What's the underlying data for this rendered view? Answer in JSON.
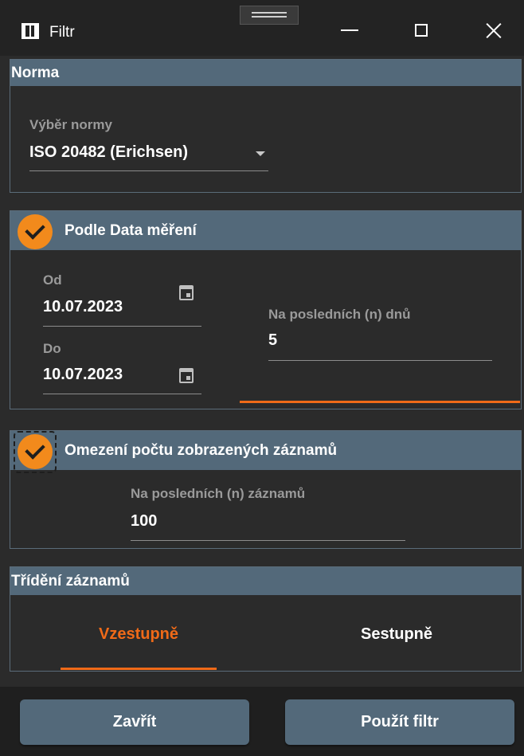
{
  "window": {
    "title": "Filtr",
    "controls": [
      "minimize-icon",
      "maximize-icon",
      "close-icon"
    ]
  },
  "norma": {
    "header": "Norma",
    "label": "Výběr normy",
    "value": "ISO 20482 (Erichsen)"
  },
  "date_filter": {
    "header": "Podle Data měření",
    "checked": true,
    "from_label": "Od",
    "from_value": "10.07.2023",
    "to_label": "Do",
    "to_value": "10.07.2023",
    "days_label": "Na posledních (n) dnů",
    "days_value": "5"
  },
  "count_filter": {
    "header": "Omezení počtu zobrazených záznamů",
    "checked": true,
    "records_label": "Na posledních (n) záznamů",
    "records_value": "100"
  },
  "sorting": {
    "header": "Třídění záznamů",
    "options": [
      {
        "label": "Vzestupně",
        "selected": true
      },
      {
        "label": "Sestupně",
        "selected": false
      }
    ]
  },
  "footer": {
    "close_label": "Zavřít",
    "apply_label": "Použít filtr"
  },
  "colors": {
    "accent": "#f06a18",
    "checkbox": "#f28a1c",
    "header_bar": "#53697a",
    "background": "#2b2b2b"
  }
}
